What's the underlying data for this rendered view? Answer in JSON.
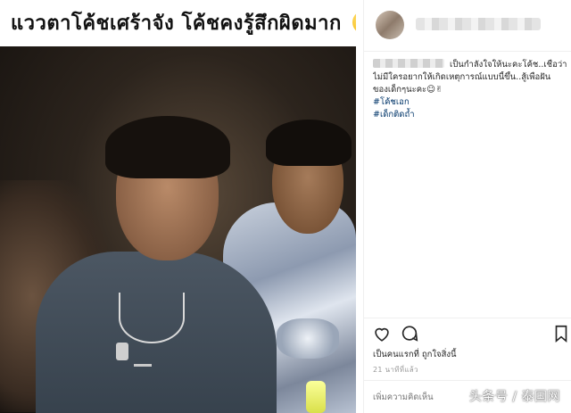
{
  "post": {
    "caption_overlay": "แววตาโค้ชเศร้าจัง  โค้ชคงรู้สึกผิดมาก",
    "emoji_icon": "pensive-face-emoji"
  },
  "panel": {
    "caption_lines": [
      "เป็นกำลังใจให้นะคะโค้ช..เชื่อว่า",
      "ไม่มีใครอยากให้เกิดเหตุการณ์แบบนี้ขึ้น..สู้เพื่อฝัน",
      "ของเด็กๆนะคะ☺✌"
    ],
    "hashtags": [
      "#โค้ชเอก",
      "#เด็กติดถ้ำ"
    ],
    "liked_by": "เป็นคนแรกที่ ถูกใจสิ่งนี้",
    "timestamp": "21 นาทีที่แล้ว",
    "comment_placeholder": "เพิ่มความคิดเห็น",
    "icons": {
      "like": "heart-icon",
      "comment": "comment-icon",
      "save": "bookmark-icon"
    }
  },
  "watermark": "头条号 / 泰国网",
  "colors": {
    "hashtag": "#003569",
    "timestamp": "#999999",
    "border": "#efefef"
  }
}
